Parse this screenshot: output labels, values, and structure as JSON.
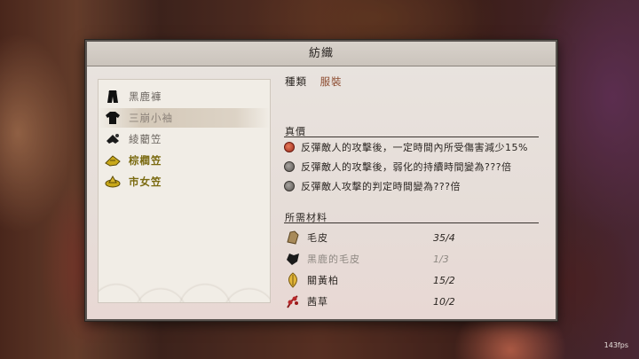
{
  "title": "紡織",
  "items": [
    {
      "label": "黑鹿褲",
      "icon": "black-trousers-icon",
      "state": "normal"
    },
    {
      "label": "三崩小袖",
      "icon": "black-kosode-icon",
      "state": "selected"
    },
    {
      "label": "綾藺笠",
      "icon": "dark-hat-icon",
      "state": "normal"
    },
    {
      "label": "棕櫚笠",
      "icon": "gold-hat-icon",
      "state": "gold"
    },
    {
      "label": "市女笠",
      "icon": "gold-wide-hat-icon",
      "state": "gold"
    }
  ],
  "detail": {
    "kind_label": "種類",
    "kind_value": "服裝",
    "true_value_title": "真價",
    "effects": [
      {
        "text": "反彈敵人的攻擊後，一定時間內所受傷害減少15%",
        "dot": "red"
      },
      {
        "text": "反彈敵人的攻擊後，弱化的持續時間變為???倍",
        "dot": "grey"
      },
      {
        "text": "反彈敵人攻擊的判定時間變為???倍",
        "dot": "grey"
      }
    ],
    "materials_title": "所需材料",
    "materials": [
      {
        "name": "毛皮",
        "count": "35/4",
        "icon": "fur-icon",
        "faded": false
      },
      {
        "name": "黑鹿的毛皮",
        "count": "1/3",
        "icon": "black-deer-fur-icon",
        "faded": true
      },
      {
        "name": "關黃柏",
        "count": "15/2",
        "icon": "cork-tree-icon",
        "faded": false
      },
      {
        "name": "茜草",
        "count": "10/2",
        "icon": "madder-icon",
        "faded": false
      }
    ]
  },
  "fps": "143fps",
  "colors": {
    "accent": "#8c4a2e",
    "gold": "#7a6a10",
    "panel": "#e9e4df"
  }
}
